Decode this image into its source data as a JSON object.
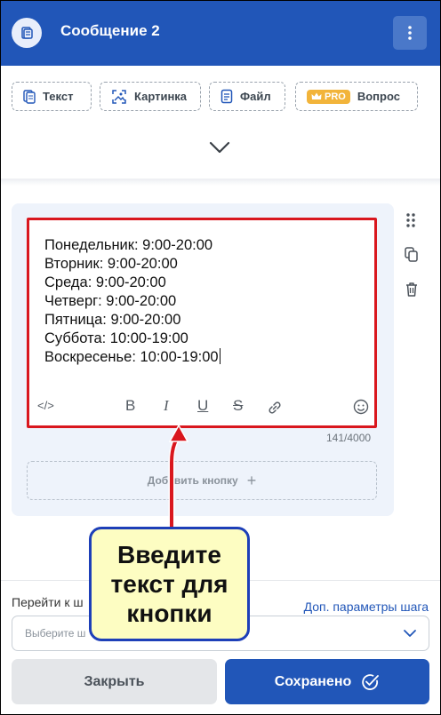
{
  "header": {
    "title": "Сообщение 2",
    "icon": "message-doc-icon",
    "menu_icon": "kebab-menu-icon"
  },
  "types": [
    {
      "label": "Текст",
      "icon": "text-doc-icon"
    },
    {
      "label": "Картинка",
      "icon": "image-icon"
    },
    {
      "label": "Файл",
      "icon": "file-icon"
    },
    {
      "label": "Вопрос",
      "badge": "PRO",
      "icon": "crown-icon"
    }
  ],
  "editor": {
    "lines": [
      "Понедельник: 9:00-20:00",
      "Вторник: 9:00-20:00",
      "Среда: 9:00-20:00",
      "Четверг: 9:00-20:00",
      "Пятница: 9:00-20:00",
      "Суббота: 10:00-19:00",
      "Воскресенье: 10:00-19:00"
    ],
    "counter": "141/4000",
    "toolbar": {
      "code": "</>",
      "bold": "B",
      "italic": "I",
      "underline": "U",
      "strike": "S"
    }
  },
  "add_button": {
    "label": "Добавить кнопку",
    "plus": "+"
  },
  "footer": {
    "goto_label": "Перейти к ш",
    "params_link": "Доп. параметры шага",
    "select_placeholder": "Выберите ш",
    "close_label": "Закрыть",
    "save_label": "Сохранено"
  },
  "callout": {
    "text": "Введите\nтекст для\nкнопки"
  },
  "colors": {
    "primary": "#2156b8",
    "highlight": "#d9171e",
    "pro": "#f2b43a",
    "callout_bg": "#fdfdc2",
    "callout_border": "#1d3fb8"
  }
}
